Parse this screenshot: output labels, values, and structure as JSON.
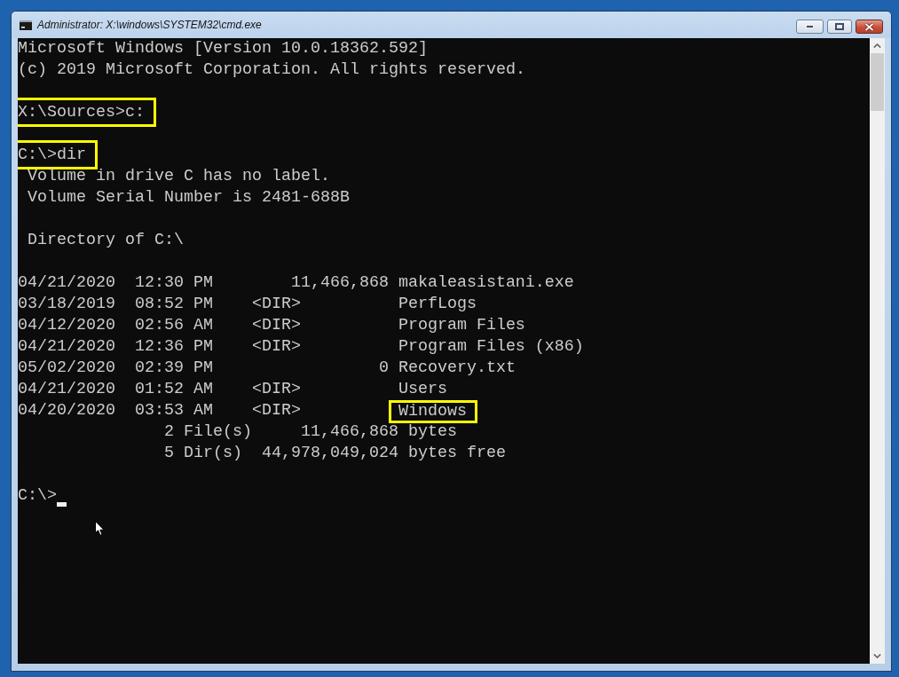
{
  "window": {
    "title": "Administrator: X:\\windows\\SYSTEM32\\cmd.exe"
  },
  "console": {
    "lines": [
      {
        "kind": "text",
        "text": "Microsoft Windows [Version 10.0.18362.592]"
      },
      {
        "kind": "text",
        "text": "(c) 2019 Microsoft Corporation. All rights reserved."
      },
      {
        "kind": "blank"
      },
      {
        "kind": "command",
        "text": "X:\\Sources>c:",
        "highlighted": true
      },
      {
        "kind": "blank"
      },
      {
        "kind": "command",
        "text": "C:\\>dir",
        "highlighted": true
      },
      {
        "kind": "detail",
        "text": "Volume in drive C has no label."
      },
      {
        "kind": "detail",
        "text": "Volume Serial Number is 2481-688B"
      },
      {
        "kind": "blank"
      },
      {
        "kind": "detail",
        "text": "Directory of C:\\"
      },
      {
        "kind": "blank"
      },
      {
        "kind": "entry",
        "date": "04/21/2020",
        "time": "12:30 PM",
        "size": "11,466,868",
        "name": "makaleasistani.exe",
        "highlighted": false
      },
      {
        "kind": "entry",
        "date": "03/18/2019",
        "time": "08:52 PM",
        "dir_tag": "<DIR>",
        "name": "PerfLogs",
        "highlighted": false
      },
      {
        "kind": "entry",
        "date": "04/12/2020",
        "time": "02:56 AM",
        "dir_tag": "<DIR>",
        "name": "Program Files",
        "highlighted": false
      },
      {
        "kind": "entry",
        "date": "04/21/2020",
        "time": "12:36 PM",
        "dir_tag": "<DIR>",
        "name": "Program Files (x86)",
        "highlighted": false
      },
      {
        "kind": "entry",
        "date": "05/02/2020",
        "time": "02:39 PM",
        "size": "0",
        "name": "Recovery.txt",
        "highlighted": false
      },
      {
        "kind": "entry",
        "date": "04/21/2020",
        "time": "01:52 AM",
        "dir_tag": "<DIR>",
        "name": "Users",
        "highlighted": false
      },
      {
        "kind": "entry",
        "date": "04/20/2020",
        "time": "03:53 AM",
        "dir_tag": "<DIR>",
        "name": "Windows",
        "highlighted": true
      },
      {
        "kind": "summary",
        "count": "2",
        "label": "File(s)",
        "size": "11,466,868",
        "unit": "bytes"
      },
      {
        "kind": "summary",
        "count": "5",
        "label": "Dir(s)",
        "size": "44,978,049,024",
        "unit": "bytes free"
      },
      {
        "kind": "blank"
      },
      {
        "kind": "prompt",
        "text": "C:\\>",
        "cursor": true
      }
    ]
  }
}
